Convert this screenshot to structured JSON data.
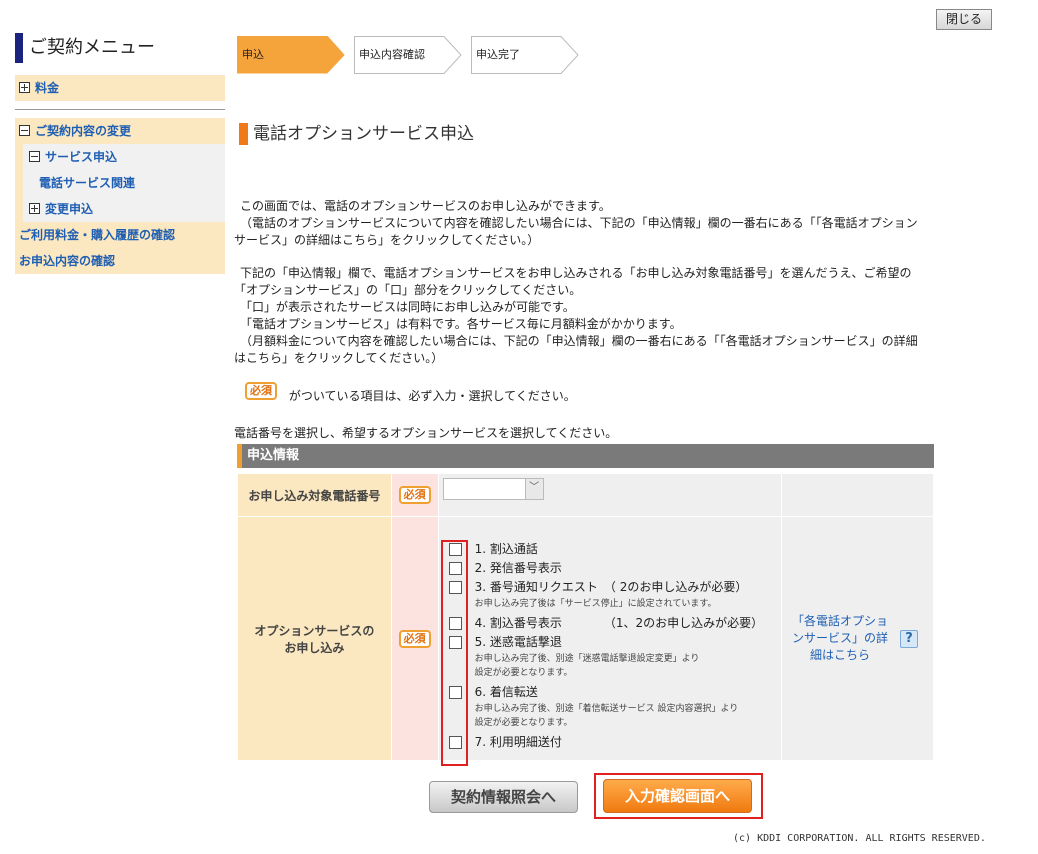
{
  "close_label": "閉じる",
  "sidebar": {
    "title": "ご契約メニュー",
    "fees": "料金",
    "contract_change": "ご契約内容の変更",
    "service_apply": "サービス申込",
    "phone_services": "電話サービス関連",
    "change_apply": "変更申込",
    "usage_history": "ご利用料金・購入履歴の確認",
    "application_check": "お申込内容の確認"
  },
  "steps": [
    "申込",
    "申込内容確認",
    "申込完了"
  ],
  "page_title": "電話オプションサービス申込",
  "intro": {
    "p1_line1": "この画面では、電話のオプションサービスのお申し込みができます。",
    "p1_line2": "（電話のオプションサービスについて内容を確認したい場合には、下記の「申込情報」欄の一番右にある「「各電話オプション",
    "p1_line3": "サービス」の詳細はこちら」をクリックしてください。）",
    "p2_line1": "下記の「申込情報」欄で、電話オプションサービスをお申し込みされる「お申し込み対象電話番号」を選んだうえ、ご希望の",
    "p2_line2": "「オプションサービス」の「口」部分をクリックしてください。",
    "p2_line3": "「口」が表示されたサービスは同時にお申し込みが可能です。",
    "p2_line4": "「電話オプションサービス」は有料です。各サービス毎に月額料金がかかります。",
    "p2_line5": "（月額料金について内容を確認したい場合には、下記の「申込情報」欄の一番右にある「「各電話オプションサービス」の詳細",
    "p2_line6": "はこちら」をクリックしてください。）"
  },
  "required_badge": "必須",
  "required_note": "がついている項目は、必ず入力・選択してください。",
  "select_instruction": "電話番号を選択し、希望するオプションサービスを選択してください。",
  "form": {
    "header": "申込情報",
    "phone_label": "お申し込み対象電話番号",
    "phone_value": "",
    "options_label_1": "オプションサービスの",
    "options_label_2": "お申し込み",
    "options": [
      {
        "label": "1. 割込通話",
        "note": ""
      },
      {
        "label": "2. 発信番号表示",
        "note": ""
      },
      {
        "label": "3. 番号通知リクエスト　（ 2のお申し込みが必要）",
        "note": "お申し込み完了後は「サービス停止」に設定されています。"
      },
      {
        "label": "4. 割込番号表示　　　　（1、2のお申し込みが必要）",
        "note": ""
      },
      {
        "label": "5. 迷惑電話撃退",
        "note": "お申し込み完了後、別途「迷惑電話撃退設定変更」より",
        "note2": "設定が必要となります。"
      },
      {
        "label": "6. 着信転送",
        "note": "お申し込み完了後、別途「着信転送サービス 設定内容選択」より",
        "note2": "設定が必要となります。"
      },
      {
        "label": "7. 利用明細送付",
        "note": ""
      }
    ],
    "detail_link": "「各電話オプションサービス」の詳細はこちら",
    "help_glyph": "?"
  },
  "buttons": {
    "contract_info": "契約情報照会へ",
    "confirm": "入力確認画面へ"
  },
  "copyright": "(c) KDDI CORPORATION. ALL RIGHTS RESERVED.",
  "colors": {
    "accent_orange": "#f07a1a",
    "sidebar_bg": "#fbe7c0",
    "link_blue": "#1f5fb3",
    "highlight_red": "#e02020"
  }
}
